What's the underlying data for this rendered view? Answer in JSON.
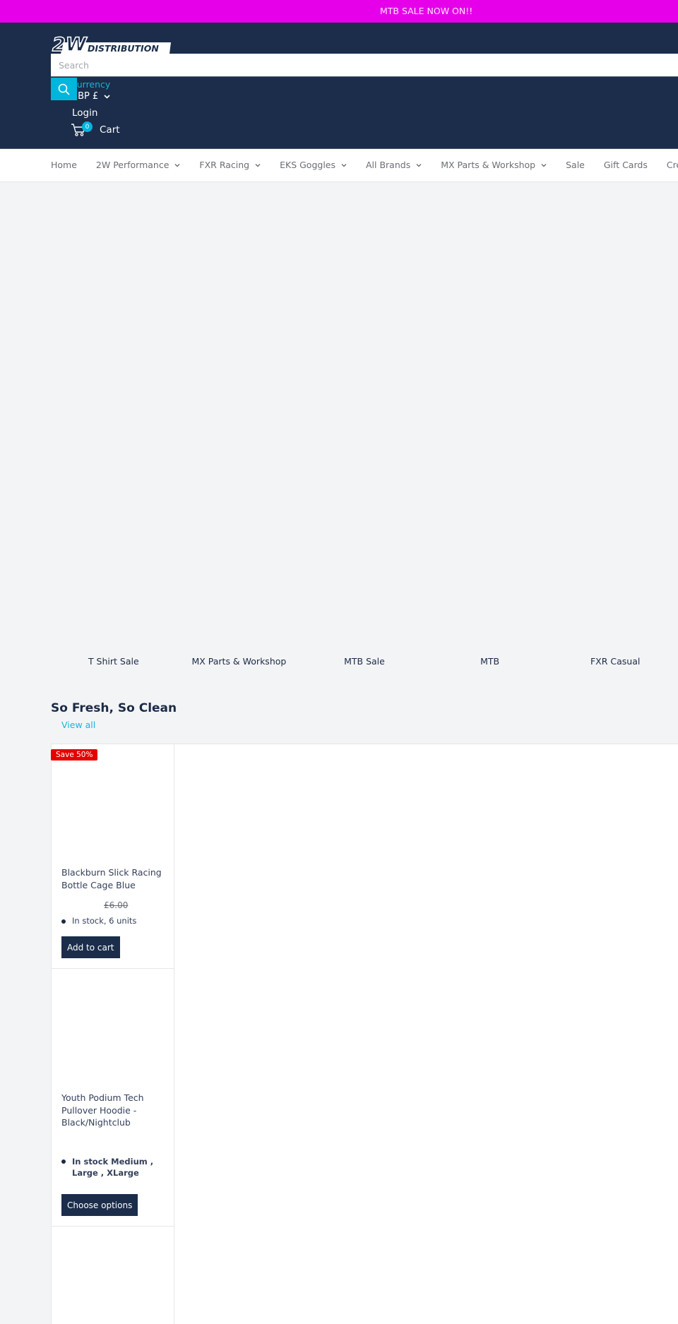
{
  "announcement": {
    "text": "MTB SALE NOW ON!!",
    "background": "#e600e9"
  },
  "header": {
    "logo_alt": "2W Distribution",
    "logo_top": "2W",
    "logo_bottom": "DISTRIBUTION",
    "search": {
      "placeholder": "Search",
      "value": ""
    },
    "search_icon": "search-icon",
    "currency_label": "Currency",
    "currency_value": "GBP £",
    "login_label": "Login",
    "cart": {
      "label": "Cart",
      "count": "0",
      "icon": "cart-icon"
    },
    "accent": "#00b6dd",
    "background": "#1b2d4a"
  },
  "nav": {
    "items": [
      {
        "label": "Home",
        "dropdown": false
      },
      {
        "label": "2W Performance",
        "dropdown": true
      },
      {
        "label": "FXR Racing",
        "dropdown": true
      },
      {
        "label": "EKS Goggles",
        "dropdown": true
      },
      {
        "label": "All Brands",
        "dropdown": true
      },
      {
        "label": "MX Parts & Workshop",
        "dropdown": true
      },
      {
        "label": "Sale",
        "dropdown": false
      },
      {
        "label": "Gift Cards",
        "dropdown": false
      },
      {
        "label": "Create",
        "dropdown": false
      }
    ]
  },
  "collections": [
    {
      "label": "T Shirt Sale"
    },
    {
      "label": "MX Parts & Workshop"
    },
    {
      "label": "MTB Sale"
    },
    {
      "label": "MTB"
    },
    {
      "label": "FXR Casual"
    }
  ],
  "featured": {
    "title": "So Fresh, So Clean",
    "view_all": "View all",
    "products": [
      {
        "badge": "Save 50%",
        "title": "Blackburn Slick Racing Bottle Cage Blue",
        "compare_price": "£6.00",
        "stock": "In stock, 6 units",
        "button": "Add to cart"
      },
      {
        "title": "Youth Podium Tech Pullover Hoodie - Black/Nightclub",
        "stock": "In stock   Medium , Large , XLarge",
        "button": "Choose options"
      }
    ]
  }
}
